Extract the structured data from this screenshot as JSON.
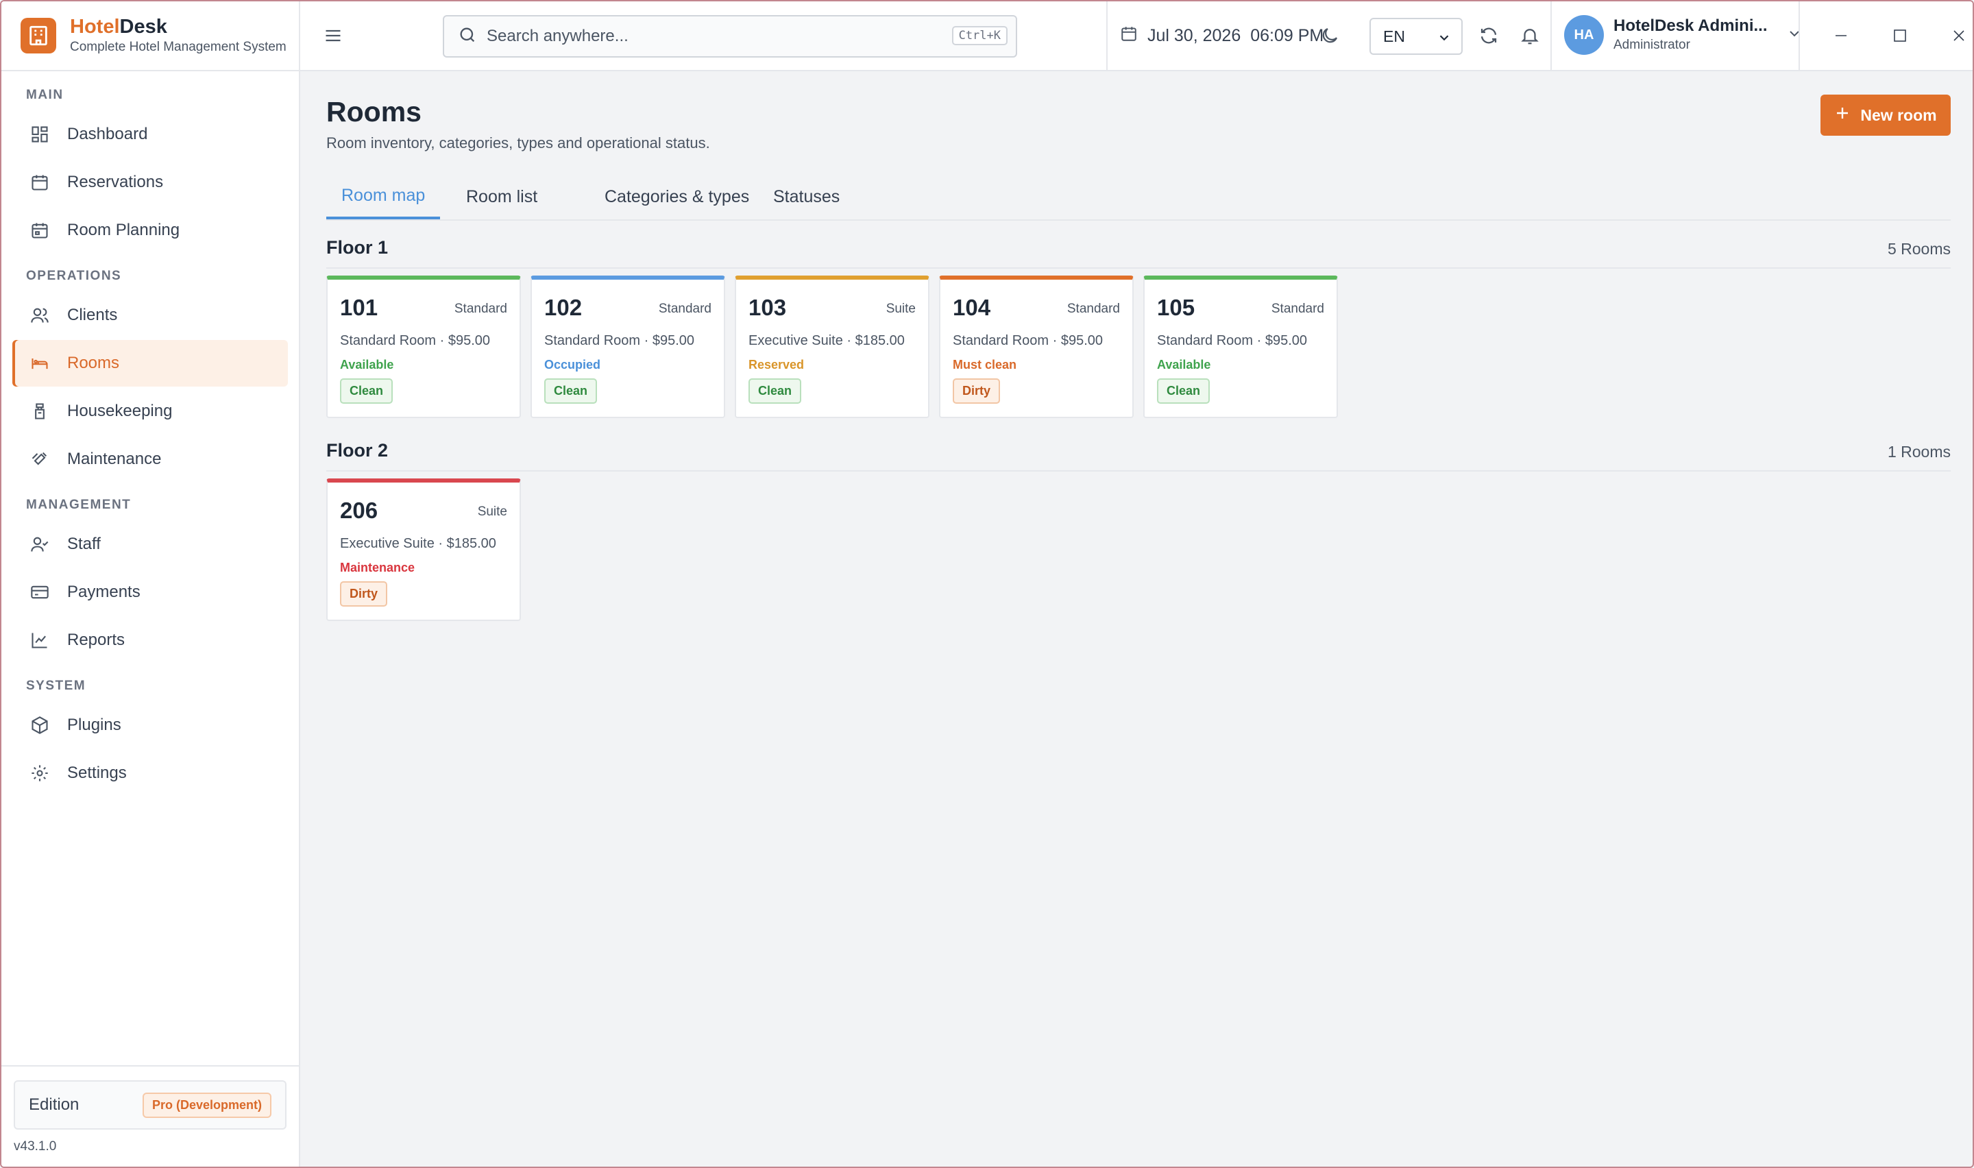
{
  "app": {
    "name_part1": "Hotel",
    "name_part2": "Desk",
    "tagline": "Complete Hotel Management System",
    "accent": "#e0702a"
  },
  "sidebar": {
    "sections": [
      {
        "title": "MAIN"
      },
      {
        "title": "OPERATIONS"
      },
      {
        "title": "MANAGEMENT"
      },
      {
        "title": "SYSTEM"
      }
    ],
    "items": [
      {
        "label": "Dashboard",
        "icon": "dashboard-icon"
      },
      {
        "label": "Reservations",
        "icon": "calendar-icon"
      },
      {
        "label": "Room Planning",
        "icon": "calendar-grid-icon"
      },
      {
        "label": "Clients",
        "icon": "users-icon"
      },
      {
        "label": "Rooms",
        "icon": "bed-icon",
        "active": true
      },
      {
        "label": "Housekeeping",
        "icon": "housekeeping-icon"
      },
      {
        "label": "Maintenance",
        "icon": "wrench-icon"
      },
      {
        "label": "Staff",
        "icon": "user-check-icon"
      },
      {
        "label": "Payments",
        "icon": "credit-card-icon"
      },
      {
        "label": "Reports",
        "icon": "chart-line-icon"
      },
      {
        "label": "Plugins",
        "icon": "package-icon"
      },
      {
        "label": "Settings",
        "icon": "gear-icon"
      }
    ],
    "edition_label": "Edition",
    "edition_value": "Pro (Development)",
    "version": "v43.1.0"
  },
  "topbar": {
    "search_placeholder": "Search anywhere...",
    "search_shortcut": "Ctrl+K",
    "date": "Jul 30, 2026",
    "time": "06:09 PM",
    "language": "EN",
    "user_initials": "HA",
    "user_name": "HotelDesk Admini...",
    "user_role": "Administrator"
  },
  "page": {
    "title": "Rooms",
    "subtitle": "Room inventory, categories, types and operational status.",
    "new_button": "New room",
    "tabs": [
      {
        "label": "Room map",
        "active": true
      },
      {
        "label": "Room list"
      },
      {
        "label": "Categories & types"
      },
      {
        "label": "Statuses"
      }
    ]
  },
  "floors": [
    {
      "title": "Floor 1",
      "count": "5 Rooms",
      "rooms": [
        {
          "number": "101",
          "category": "Standard",
          "desc": "Standard Room · $95.00",
          "status": "Available",
          "status_color": "#3fa34d",
          "bar_color": "#5cb85c",
          "hk": "Clean"
        },
        {
          "number": "102",
          "category": "Standard",
          "desc": "Standard Room · $95.00",
          "status": "Occupied",
          "status_color": "#4a90d9",
          "bar_color": "#5c9be0",
          "hk": "Clean"
        },
        {
          "number": "103",
          "category": "Suite",
          "desc": "Executive Suite · $185.00",
          "status": "Reserved",
          "status_color": "#d9952a",
          "bar_color": "#e0a030",
          "hk": "Clean"
        },
        {
          "number": "104",
          "category": "Standard",
          "desc": "Standard Room · $95.00",
          "status": "Must clean",
          "status_color": "#d9692a",
          "bar_color": "#e0702a",
          "hk": "Dirty"
        },
        {
          "number": "105",
          "category": "Standard",
          "desc": "Standard Room · $95.00",
          "status": "Available",
          "status_color": "#3fa34d",
          "bar_color": "#5cb85c",
          "hk": "Clean"
        }
      ]
    },
    {
      "title": "Floor 2",
      "count": "1 Rooms",
      "rooms": [
        {
          "number": "206",
          "category": "Suite",
          "desc": "Executive Suite · $185.00",
          "status": "Maintenance",
          "status_color": "#d9363e",
          "bar_color": "#d9474f",
          "hk": "Dirty"
        }
      ]
    }
  ]
}
